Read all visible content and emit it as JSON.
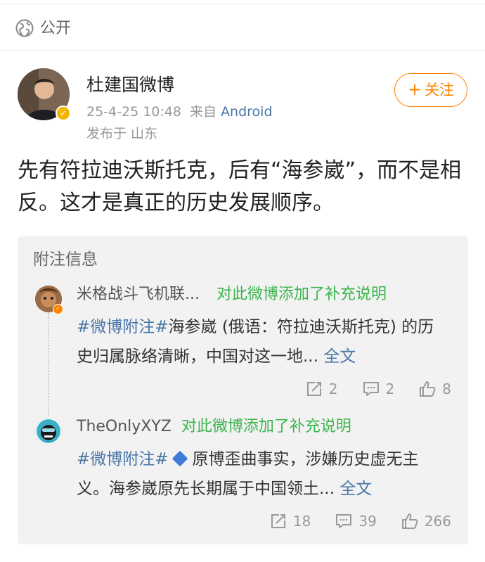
{
  "visibility": {
    "label": "公开"
  },
  "author": {
    "name": "杜建国微博",
    "time": "25-4-25 10:48",
    "source_prefix": "来自",
    "source": "Android",
    "location": "发布于 山东",
    "follow_label": "关注"
  },
  "post": {
    "text": "先有符拉迪沃斯托克，后有“海参崴”，而不是相反。这才是真正的历史发展顺序。"
  },
  "notes": {
    "title": "附注信息",
    "items": [
      {
        "user": "米格战斗飞机联...",
        "action": "对此微博添加了补充说明",
        "hashtag": "#微博附注#",
        "text": "海参崴 (俄语：符拉迪沃斯托克) 的历史归属脉络清晰，中国对这一地...",
        "fulltext": "全文",
        "reposts": "2",
        "comments": "2",
        "likes": "8"
      },
      {
        "user": "TheOnlyXYZ",
        "action": "对此微博添加了补充说明",
        "hashtag": "#微博附注#",
        "text": "原博歪曲事实，涉嫌历史虚无主义。海参崴原先长期属于中国领土...",
        "fulltext": "全文",
        "reposts": "18",
        "comments": "39",
        "likes": "266"
      }
    ]
  },
  "colors": {
    "accent_orange": "#ff8200",
    "link_blue": "#4a76a8",
    "note_green": "#3cb44b"
  }
}
